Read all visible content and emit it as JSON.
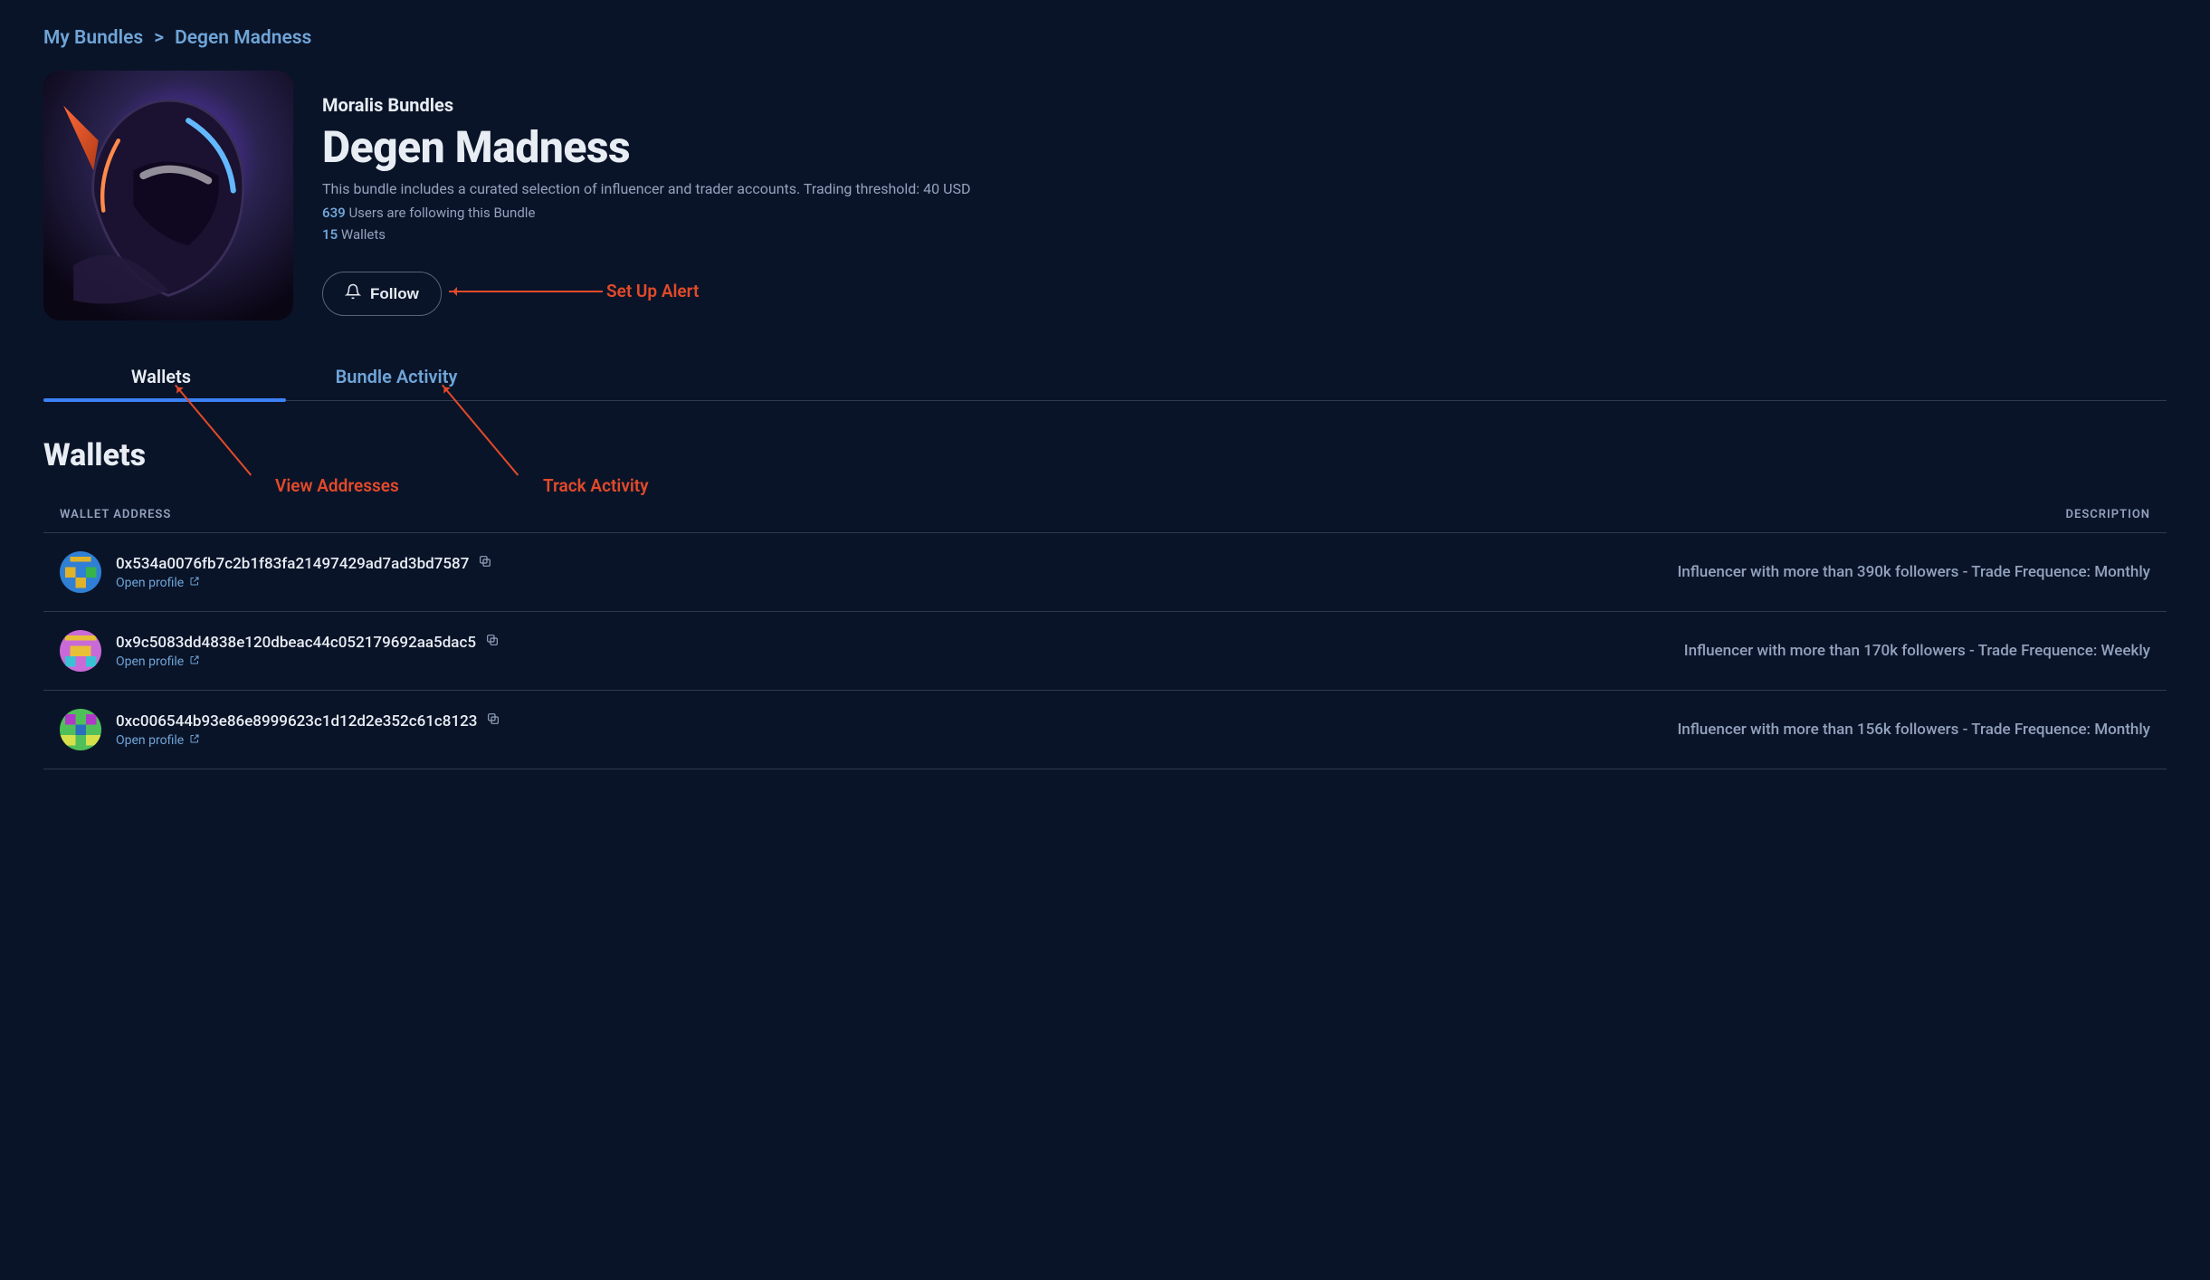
{
  "breadcrumb": {
    "root": "My Bundles",
    "current": "Degen Madness"
  },
  "header": {
    "overline": "Moralis Bundles",
    "title": "Degen Madness",
    "description": "This bundle includes a curated selection of influencer and trader accounts. Trading threshold: 40 USD",
    "followers_count": "639",
    "followers_label": "Users are following this Bundle",
    "wallets_count": "15",
    "wallets_label": "Wallets",
    "follow_label": "Follow"
  },
  "tabs": {
    "wallets": "Wallets",
    "activity": "Bundle Activity"
  },
  "section": {
    "title": "Wallets"
  },
  "table": {
    "col_address": "WALLET ADDRESS",
    "col_description": "DESCRIPTION",
    "open_profile_label": "Open profile"
  },
  "wallets": [
    {
      "address": "0x534a0076fb7c2b1f83fa21497429ad7ad3bd7587",
      "description": "Influencer with more than 390k followers - Trade Frequence: Monthly"
    },
    {
      "address": "0x9c5083dd4838e120dbeac44c052179692aa5dac5",
      "description": "Influencer with more than 170k followers - Trade Frequence: Weekly"
    },
    {
      "address": "0xc006544b93e86e8999623c1d12d2e352c61c8123",
      "description": "Influencer with more than 156k followers - Trade Frequence: Monthly"
    }
  ],
  "annotations": {
    "set_up_alert": "Set Up Alert",
    "view_addresses": "View Addresses",
    "track_activity": "Track Activity"
  }
}
